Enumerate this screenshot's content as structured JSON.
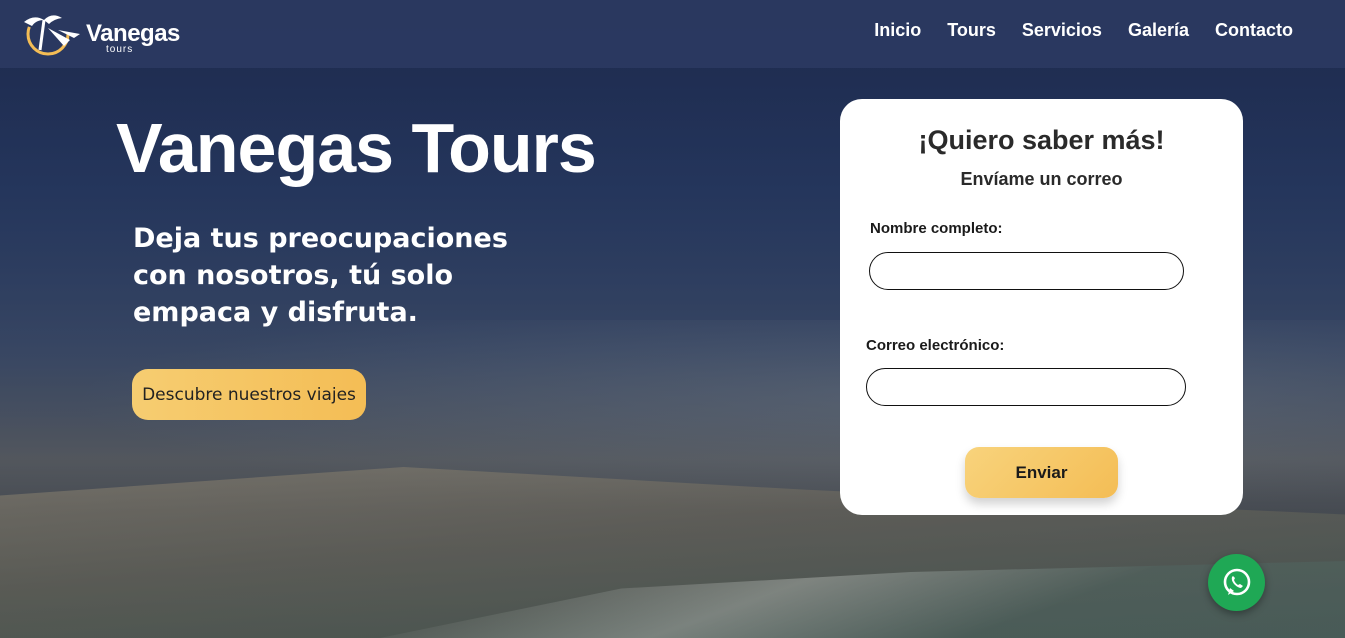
{
  "brand": {
    "name": "Vanegas",
    "tagline": "tours"
  },
  "nav": {
    "items": [
      "Inicio",
      "Tours",
      "Servicios",
      "Galería",
      "Contacto"
    ]
  },
  "hero": {
    "title": "Vanegas Tours",
    "subtitle": "Deja tus preocupaciones con nosotros, tú solo empaca y disfruta.",
    "cta_label": "Descubre nuestros viajes"
  },
  "form": {
    "title": "¡Quiero saber más!",
    "subtitle": "Envíame un correo",
    "name_label": "Nombre completo:",
    "name_value": "",
    "email_label": "Correo electrónico:",
    "email_value": "",
    "submit_label": "Enviar"
  },
  "colors": {
    "accent": "#f4bd55",
    "navbar": "#2c3a62",
    "whatsapp": "#1fa855"
  },
  "icons": {
    "logo": "palm-plane-logo-icon",
    "chat": "whatsapp-icon"
  }
}
